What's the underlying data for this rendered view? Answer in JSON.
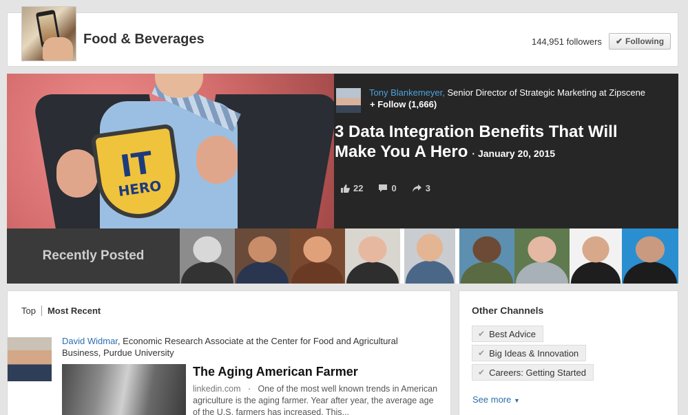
{
  "header": {
    "title": "Food & Beverages",
    "followers": "144,951 followers",
    "following_label": "Following"
  },
  "featured": {
    "author_name": "Tony Blankemeyer,",
    "author_title": " Senior Director of Strategic Marketing at Zipscene",
    "follow_label": "+ Follow (1,666)",
    "title": "3 Data Integration Benefits That Will Make You A Hero",
    "date": "· January 20, 2015",
    "likes": "22",
    "comments": "0",
    "shares": "3",
    "image_text_it": "IT",
    "image_text_hero": "HERO"
  },
  "recent": {
    "label": "Recently Posted",
    "thumbs": [
      {
        "color": "#8c8c8c",
        "face": "#d8d8d8",
        "suit": "#333"
      },
      {
        "color": "#6a4a38",
        "face": "#c98d6a",
        "suit": "#2a3550"
      },
      {
        "color": "#7a4a30",
        "face": "#e0a17a",
        "suit": "#6b3a24"
      },
      {
        "color": "#d9d6d0",
        "face": "#e7b8a0",
        "suit": "#2e2e2e"
      },
      {
        "color": "#c9ccd0",
        "face": "#e3b592",
        "suit": "#4a6788"
      },
      {
        "color": "#5d8fb0",
        "face": "#6d4a35",
        "suit": "#5a6a42"
      },
      {
        "color": "#5f7a4e",
        "face": "#e4b8a2",
        "suit": "#a8b0b8"
      },
      {
        "color": "#f2f2f2",
        "face": "#d8a88a",
        "suit": "#1e1e1e"
      },
      {
        "color": "#2a8fd0",
        "face": "#c99a80",
        "suit": "#1c1c1c"
      }
    ]
  },
  "feed": {
    "tab_top": "Top",
    "tab_recent": "Most Recent",
    "post": {
      "author_name": "David Widmar",
      "author_title": ", Economic Research Associate at the Center for Food and Agricultural Business, Purdue University",
      "title": "The Aging American Farmer",
      "source": "linkedin.com",
      "excerpt": "One of the most well known trends in American agriculture is the aging farmer. Year after year, the average age of the U.S. farmers has increased. This..."
    }
  },
  "sidebar": {
    "title": "Other Channels",
    "channels": [
      "Best Advice",
      "Big Ideas & Innovation",
      "Careers: Getting Started"
    ],
    "see_more": "See more"
  },
  "colors": {
    "link": "#2a6eb0",
    "hero_name": "#4aa3df",
    "hero_bg": "#262626"
  }
}
